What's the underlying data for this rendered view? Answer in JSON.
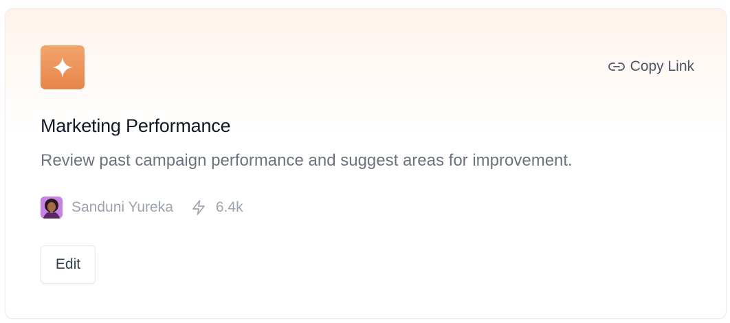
{
  "card": {
    "icon": "sparkle-icon",
    "copy_link_icon": "link-icon",
    "copy_link_label": "Copy Link",
    "title": "Marketing Performance",
    "description": "Review past campaign performance and suggest areas for improvement.",
    "author": {
      "name": "Sanduni Yureka",
      "avatar": "avatar-icon"
    },
    "usage_icon": "bolt-icon",
    "usage_count": "6.4k",
    "edit_label": "Edit"
  },
  "colors": {
    "accent": "#e98a50",
    "title": "#111827",
    "muted": "#9ca3af",
    "description": "#6b7280"
  }
}
